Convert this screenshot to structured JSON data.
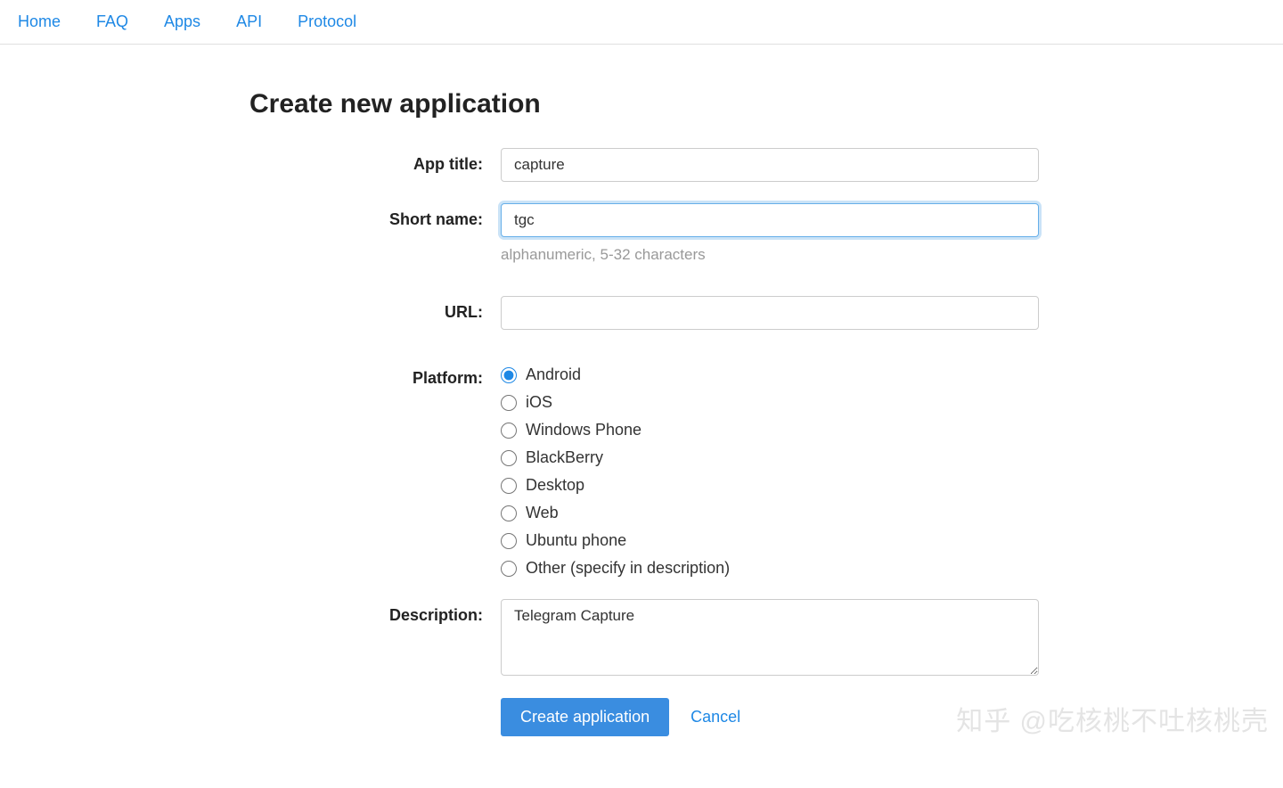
{
  "nav": {
    "items": [
      "Home",
      "FAQ",
      "Apps",
      "API",
      "Protocol"
    ]
  },
  "page": {
    "title": "Create new application"
  },
  "form": {
    "app_title": {
      "label": "App title:",
      "value": "capture"
    },
    "short_name": {
      "label": "Short name:",
      "value": "tgc",
      "help": "alphanumeric, 5-32 characters"
    },
    "url": {
      "label": "URL:",
      "value": ""
    },
    "platform": {
      "label": "Platform:",
      "selected": "Android",
      "options": [
        "Android",
        "iOS",
        "Windows Phone",
        "BlackBerry",
        "Desktop",
        "Web",
        "Ubuntu phone",
        "Other (specify in description)"
      ]
    },
    "description": {
      "label": "Description:",
      "value": "Telegram Capture"
    },
    "submit_label": "Create application",
    "cancel_label": "Cancel"
  },
  "watermark": "知乎 @吃核桃不吐核桃壳"
}
